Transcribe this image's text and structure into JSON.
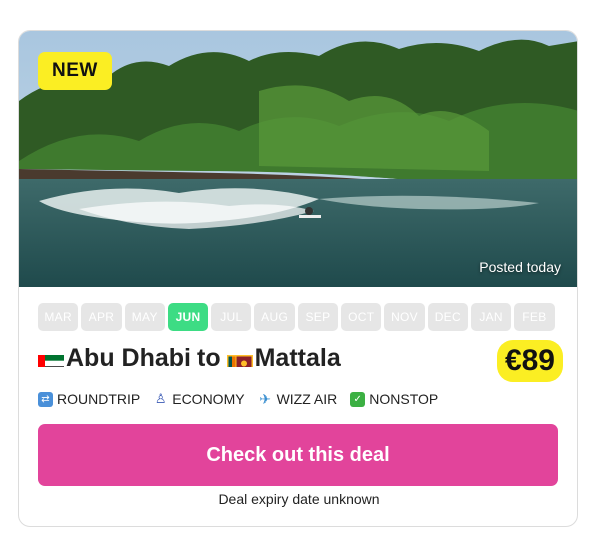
{
  "badge": {
    "label": "NEW"
  },
  "hero": {
    "posted": "Posted today"
  },
  "months": [
    {
      "label": "MAR",
      "active": false
    },
    {
      "label": "APR",
      "active": false
    },
    {
      "label": "MAY",
      "active": false
    },
    {
      "label": "JUN",
      "active": true
    },
    {
      "label": "JUL",
      "active": false
    },
    {
      "label": "AUG",
      "active": false
    },
    {
      "label": "SEP",
      "active": false
    },
    {
      "label": "OCT",
      "active": false
    },
    {
      "label": "NOV",
      "active": false
    },
    {
      "label": "DEC",
      "active": false
    },
    {
      "label": "JAN",
      "active": false
    },
    {
      "label": "FEB",
      "active": false
    }
  ],
  "route": {
    "origin": "Abu Dhabi",
    "connector": "to",
    "destination": "Mattala"
  },
  "price": "€89",
  "tags": [
    {
      "label": "ROUNDTRIP",
      "icon": "roundtrip-icon"
    },
    {
      "label": "ECONOMY",
      "icon": "seat-icon"
    },
    {
      "label": "WIZZ AIR",
      "icon": "airplane-icon"
    },
    {
      "label": "NONSTOP",
      "icon": "check-icon"
    }
  ],
  "cta": {
    "label": "Check out this deal"
  },
  "expiry": "Deal expiry date unknown",
  "colors": {
    "accent": "#e2449b",
    "highlight": "#fbee23",
    "active_month": "#3ddc84"
  }
}
